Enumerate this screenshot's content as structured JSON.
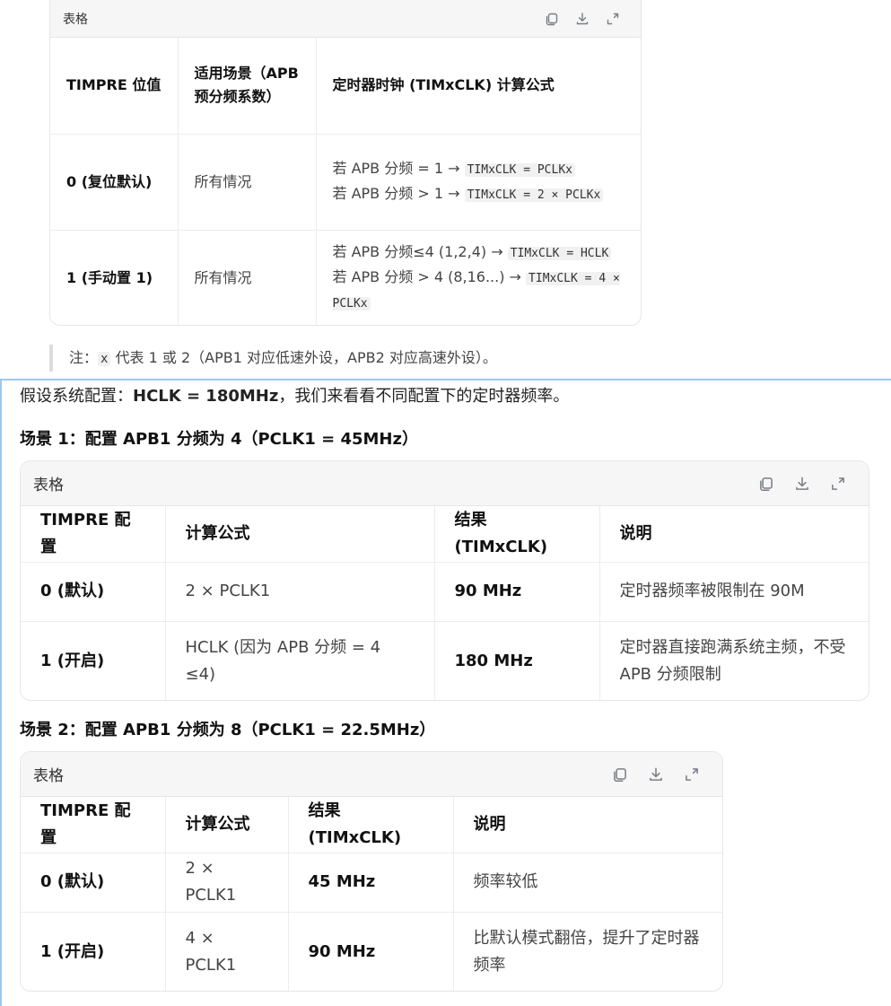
{
  "top_table": {
    "title": "表格",
    "headers": [
      "TIMPRE 位值",
      "适用场景（APB 预分频系数）",
      "定时器时钟 (TIMxCLK) 计算公式"
    ],
    "rows": [
      {
        "bit": "0 (复位默认)",
        "scene": "所有情况",
        "line1_text": "若 APB 分频 = 1 → ",
        "line1_code": "TIMxCLK = PCLKx",
        "line2_text": "若 APB 分频 > 1 → ",
        "line2_code": "TIMxCLK = 2 × PCLKx"
      },
      {
        "bit": "1 (手动置 1)",
        "scene": "所有情况",
        "line1_text": "若 APB 分频≤4 (1,2,4) → ",
        "line1_code": "TIMxCLK = HCLK",
        "line2_text": "若 APB 分频 > 4 (8,16...) → ",
        "line2_code": "TIMxCLK = 4 × PCLKx"
      }
    ]
  },
  "note": {
    "prefix": "注：",
    "code": "x",
    "text": " 代表 1 或 2（APB1 对应低速外设，APB2 对应高速外设）。"
  },
  "intro": {
    "text1": "假设系统配置：",
    "bold": "HCLK = 180MHz",
    "text2": "，我们来看看不同配置下的定时器频率。"
  },
  "scenario1": {
    "heading": "场景 1：配置 APB1 分频为 4（PCLK1 = 45MHz）",
    "table_title": "表格",
    "headers": [
      "TIMPRE 配置",
      "计算公式",
      "结果 (TIMxCLK)",
      "说明"
    ],
    "rows": [
      [
        "0 (默认)",
        "2 × PCLK1",
        "90 MHz",
        "定时器频率被限制在 90M"
      ],
      [
        "1 (开启)",
        "HCLK (因为 APB 分频 = 4 ≤4)",
        "180 MHz",
        "定时器直接跑满系统主频，不受 APB 分频限制"
      ]
    ]
  },
  "scenario2": {
    "heading": "场景 2：配置 APB1 分频为 8（PCLK1 = 22.5MHz）",
    "table_title": "表格",
    "headers": [
      "TIMPRE 配置",
      "计算公式",
      "结果 (TIMxCLK)",
      "说明"
    ],
    "rows": [
      [
        "0 (默认)",
        "2 × PCLK1",
        "45 MHz",
        "频率较低"
      ],
      [
        "1 (开启)",
        "4 × PCLK1",
        "90 MHz",
        "比默认模式翻倍，提升了定时器频率"
      ]
    ]
  },
  "icons": [
    "copy-icon",
    "download-icon",
    "expand-icon"
  ]
}
